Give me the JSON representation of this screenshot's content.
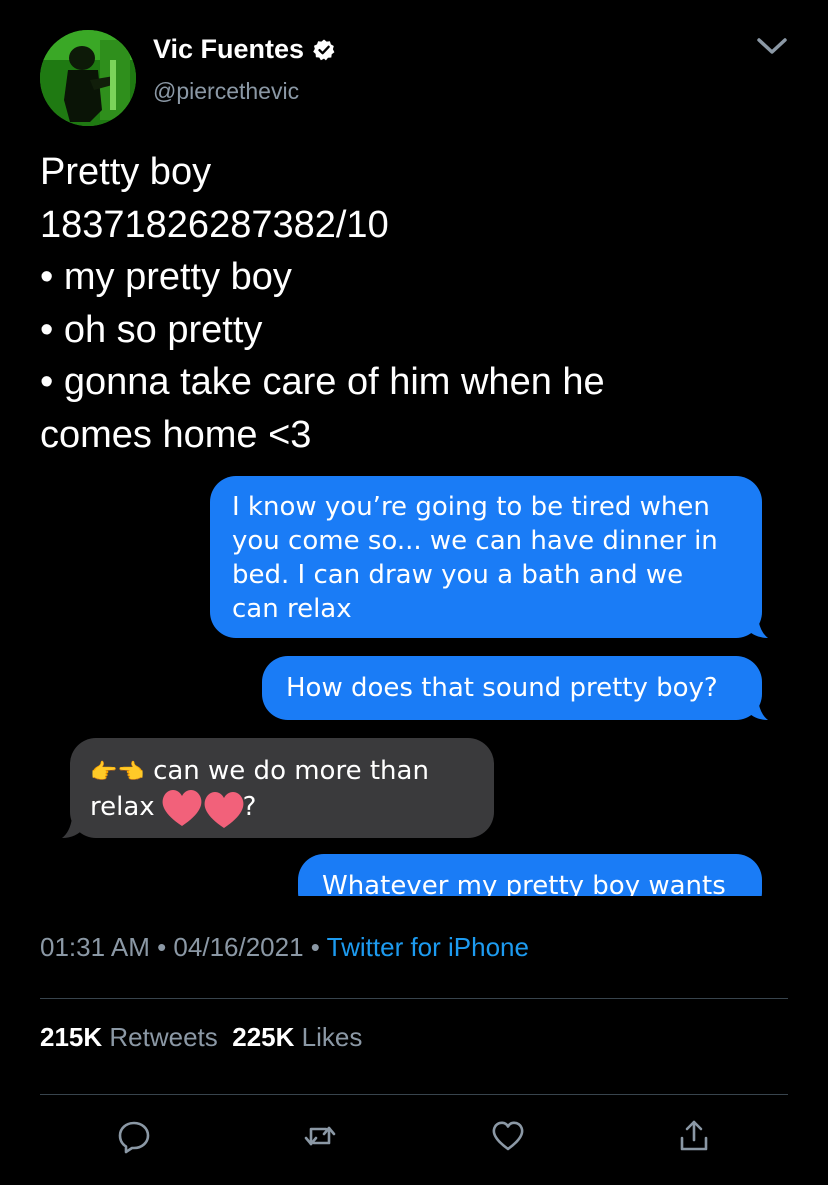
{
  "author": {
    "name": "Vic Fuentes",
    "handle": "@piercethevic"
  },
  "tweet": {
    "lines": [
      "Pretty boy",
      "18371826287382/10",
      "• my pretty boy",
      "• oh so pretty",
      "• gonna take care of him when he",
      "comes home <3"
    ]
  },
  "messages": [
    {
      "direction": "outgoing",
      "lines": [
        "I know you’re going to be tired when",
        "you come so... we can have dinner in",
        "bed. I can draw you a bath and we",
        "can relax"
      ]
    },
    {
      "direction": "outgoing",
      "lines": [
        "How does that sound pretty boy?"
      ]
    },
    {
      "direction": "incoming",
      "lead_emoji": "👉👈",
      "lines": [
        "can we do more than",
        "relax",
        "?"
      ]
    },
    {
      "direction": "outgoing",
      "lines": [
        "Whatever my pretty boy wants"
      ]
    }
  ],
  "meta": {
    "time": "01:31 AM",
    "sep": " • ",
    "date": "04/16/2021",
    "source": "Twitter for iPhone"
  },
  "stats": {
    "retweets_count": "215K",
    "retweets_label": "Retweets",
    "likes_count": "225K",
    "likes_label": "Likes"
  },
  "icons": {
    "verified": "verified-badge-icon",
    "more": "chevron-down-icon",
    "reply": "reply-icon",
    "retweet": "retweet-icon",
    "like": "heart-icon",
    "share": "share-icon"
  },
  "colors": {
    "background": "#000000",
    "link": "#1d9bf0",
    "outgoing_bubble": "#1a7cf6",
    "incoming_bubble": "#3a3a3c",
    "secondary_text": "#8b98a5"
  }
}
